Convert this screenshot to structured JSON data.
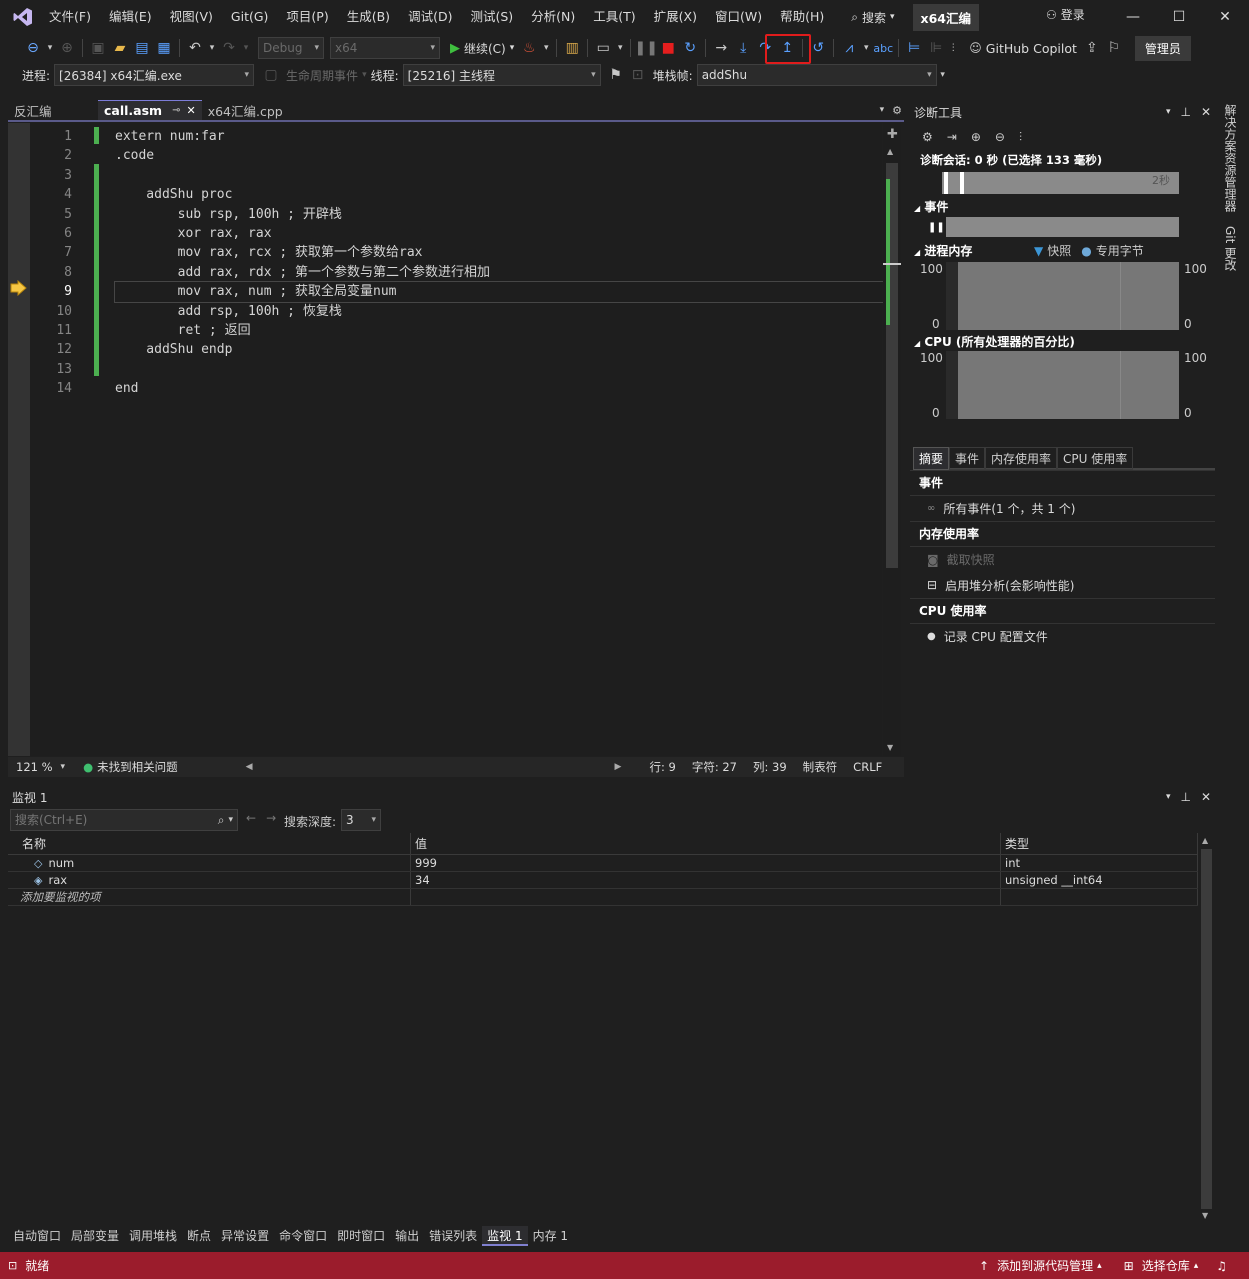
{
  "menu": [
    "文件(F)",
    "编辑(E)",
    "视图(V)",
    "Git(G)",
    "项目(P)",
    "生成(B)",
    "调试(D)",
    "测试(S)",
    "分析(N)",
    "工具(T)",
    "扩展(X)",
    "窗口(W)",
    "帮助(H)"
  ],
  "search_label": "搜索",
  "solution_name": "x64汇编",
  "login_label": "登录",
  "toolbar": {
    "config": "Debug",
    "platform": "x64",
    "continue_label": "继续(C)",
    "copilot_label": "GitHub Copilot",
    "admin_label": "管理员"
  },
  "debug_location": {
    "process_label": "进程:",
    "process_value": "[26384] x64汇编.exe",
    "lifecycle_label": "生命周期事件",
    "thread_label": "线程:",
    "thread_value": "[25216] 主线程",
    "stackframe_label": "堆栈帧:",
    "stackframe_value": "addShu"
  },
  "doc_tabs": [
    {
      "label": "反汇编",
      "active": false
    },
    {
      "label": "call.asm",
      "active": true
    },
    {
      "label": "x64汇编.cpp",
      "active": false
    }
  ],
  "editor": {
    "line_numbers": [
      "1",
      "2",
      "3",
      "4",
      "5",
      "6",
      "7",
      "8",
      "9",
      "10",
      "11",
      "12",
      "13",
      "14"
    ],
    "current_line": 9,
    "code_lines": [
      "extern num:far",
      ".code",
      "",
      "    addShu proc",
      "        sub rsp, 100h ; 开辟栈",
      "        xor rax, rax",
      "        mov rax, rcx ; 获取第一个参数给rax",
      "        add rax, rdx ; 第一个参数与第二个参数进行相加",
      "        mov rax, num ; 获取全局变量num",
      "        add rsp, 100h ; 恢复栈",
      "        ret ; 返回",
      "    addShu endp",
      "",
      "end"
    ],
    "status": {
      "zoom": "121 %",
      "issues": "未找到相关问题",
      "line": "行: 9",
      "char": "字符: 27",
      "col": "列: 39",
      "tabs": "制表符",
      "eol": "CRLF"
    }
  },
  "diagnostics": {
    "title": "诊断工具",
    "session": "诊断会话: 0 秒 (已选择 133 毫秒)",
    "timeline_label": "2秒",
    "events_title": "事件",
    "memory_title": "进程内存",
    "legend_snapshot": "快照",
    "legend_private": "专用字节",
    "cpu_title": "CPU (所有处理器的百分比)",
    "axis_max": "100",
    "axis_min": "0",
    "tabs": [
      "摘要",
      "事件",
      "内存使用率",
      "CPU 使用率"
    ],
    "sections": {
      "events_head": "事件",
      "events_item": "所有事件(1 个，共 1 个)",
      "mem_head": "内存使用率",
      "mem_snapshot": "截取快照",
      "mem_heap": "启用堆分析(会影响性能)",
      "cpu_head": "CPU 使用率",
      "cpu_record": "记录 CPU 配置文件"
    },
    "accent": "#3c96d6"
  },
  "side_tabs": [
    "解决方案资源管理器",
    "Git 更改"
  ],
  "watch": {
    "title": "监视 1",
    "search_placeholder": "搜索(Ctrl+E)",
    "depth_label": "搜索深度:",
    "depth_value": "3",
    "columns": [
      "名称",
      "值",
      "类型"
    ],
    "rows": [
      {
        "name": "num",
        "value": "999",
        "type": "int"
      },
      {
        "name": "rax",
        "value": "34",
        "type": "unsigned __int64"
      }
    ],
    "add_placeholder": "添加要监视的项"
  },
  "tool_tabs": [
    {
      "label": "自动窗口",
      "active": false
    },
    {
      "label": "局部变量",
      "active": false
    },
    {
      "label": "调用堆栈",
      "active": false
    },
    {
      "label": "断点",
      "active": false
    },
    {
      "label": "异常设置",
      "active": false
    },
    {
      "label": "命令窗口",
      "active": false
    },
    {
      "label": "即时窗口",
      "active": false
    },
    {
      "label": "输出",
      "active": false
    },
    {
      "label": "错误列表",
      "active": false
    },
    {
      "label": "监视 1",
      "active": true
    },
    {
      "label": "内存 1",
      "active": false
    }
  ],
  "statusbar": {
    "ready": "就绪",
    "add_source": "添加到源代码管理",
    "select_repo": "选择仓库",
    "bar_color": "#9b1c2c"
  }
}
